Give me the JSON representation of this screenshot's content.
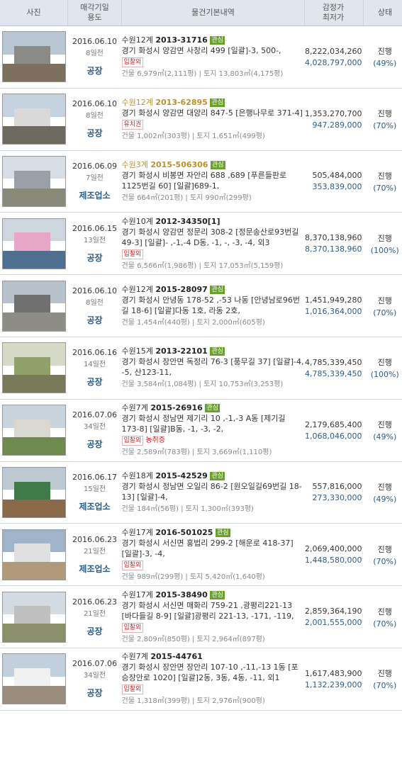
{
  "header": {
    "photo": "사진",
    "date_line1": "매각기일",
    "date_line2": "용도",
    "info": "물건기본내역",
    "price_line1": "감정가",
    "price_line2": "최저가",
    "status": "상태"
  },
  "rows": [
    {
      "date": "2016.06.10",
      "ago": "8일전",
      "usage": "공장",
      "court": "수원12계",
      "case": "2013-31716",
      "returned": false,
      "badge": "관심",
      "addr": "경기 화성시 양감면 사창리 499 [일괄]-3, 500-,",
      "tag": "입찰외",
      "tag2": "",
      "area": "건물 6,979㎡(2,111평) | 토지 13,803㎡(4,175평)",
      "appraisal": "8,222,034,260",
      "minimum": "4,028,797,000",
      "status": "진행",
      "pct": "(49%)"
    },
    {
      "date": "2016.06.10",
      "ago": "8일전",
      "usage": "공장",
      "court": "수원12계",
      "case": "2013-62895",
      "returned": true,
      "badge": "관심",
      "addr": "경기 화성시 양감면 대양리 847-5 [은행나무로 371-4]",
      "tag": "유치권",
      "tag2": "",
      "area": "건물 1,002㎡(303평) | 토지 1,651㎡(499평)",
      "appraisal": "1,353,270,700",
      "minimum": "947,289,000",
      "status": "진행",
      "pct": "(70%)"
    },
    {
      "date": "2016.06.09",
      "ago": "7일전",
      "usage": "제조업소",
      "court": "수원3계",
      "case": "2015-506306",
      "returned": true,
      "badge": "관심",
      "addr": "경기 화성시 비봉면 자안리 688 ,689 [푸른들판로1125번길 60] [일괄]689-1,",
      "tag": "",
      "tag2": "",
      "area": "건물 664㎡(201평) | 토지 990㎡(299평)",
      "appraisal": "505,484,000",
      "minimum": "353,839,000",
      "status": "진행",
      "pct": "(70%)"
    },
    {
      "date": "2016.06.15",
      "ago": "13일전",
      "usage": "공장",
      "court": "수원10계",
      "case": "2012-34350[1]",
      "returned": false,
      "badge": "",
      "addr": "경기 화성시 양감면 정문리 308-2 [정문송산로93번길 49-3] [일괄]- ,-1,-4 D동, -1, -, -3, -4, 외3",
      "tag": "입찰외",
      "tag2": "",
      "area": "건물 6,566㎡(1,986평) | 토지 17,053㎡(5,159평)",
      "appraisal": "8,370,138,960",
      "minimum": "8,370,138,960",
      "status": "진행",
      "pct": "(100%)"
    },
    {
      "date": "2016.06.10",
      "ago": "8일전",
      "usage": "공장",
      "court": "수원12계",
      "case": "2015-28097",
      "returned": false,
      "badge": "관심",
      "addr": "경기 화성시 안녕동 178-52 ,-53 나동 [안녕남로96번길 18-6] [일괄]다동 1호, 라동 2호,",
      "tag": "",
      "tag2": "",
      "area": "건물 1,454㎡(440평) | 토지 2,000㎡(605평)",
      "appraisal": "1,451,949,280",
      "minimum": "1,016,364,000",
      "status": "진행",
      "pct": "(70%)"
    },
    {
      "date": "2016.06.16",
      "ago": "14일전",
      "usage": "공장",
      "court": "수원15계",
      "case": "2013-22101",
      "returned": false,
      "badge": "관심",
      "addr": "경기 화성시 장안면 독정리 76-3 [풍무길 37] [일괄]-4, -5, 산123-11,",
      "tag": "",
      "tag2": "",
      "area": "건물 3,584㎡(1,084평) | 토지 10,753㎡(3,253평)",
      "appraisal": "4,785,339,450",
      "minimum": "4,785,339,450",
      "status": "진행",
      "pct": "(100%)"
    },
    {
      "date": "2016.07.06",
      "ago": "34일전",
      "usage": "공장",
      "court": "수원7계",
      "case": "2015-26916",
      "returned": false,
      "badge": "관심",
      "addr": "경기 화성시 정남면 제기리 10 ,-1,-3 A동 [제기길 173-8] [일괄]B동, -1, -3, -2,",
      "tag": "입찰외",
      "tag2": "농취증",
      "area": "건물 2,589㎡(783평) | 토지 3,669㎡(1,110평)",
      "appraisal": "2,179,685,400",
      "minimum": "1,068,046,000",
      "status": "진행",
      "pct": "(49%)"
    },
    {
      "date": "2016.06.17",
      "ago": "15일전",
      "usage": "제조업소",
      "court": "수원18계",
      "case": "2015-42529",
      "returned": false,
      "badge": "관심",
      "addr": "경기 화성시 정남면 오일리 86-2 [원오일길69번길 18-13] [일괄]-4,",
      "tag": "",
      "tag2": "",
      "area": "건물 184㎡(56평) | 토지 1,300㎡(393평)",
      "appraisal": "557,816,000",
      "minimum": "273,330,000",
      "status": "진행",
      "pct": "(49%)"
    },
    {
      "date": "2016.06.23",
      "ago": "21일전",
      "usage": "제조업소",
      "court": "수원17계",
      "case": "2016-501025",
      "returned": false,
      "badge": "관심",
      "addr": "경기 화성시 서신면 홍법리 299-2 [해운로 418-37] [일괄]-3, -4,",
      "tag": "입찰외",
      "tag2": "",
      "area": "건물 989㎡(299평) | 토지 5,420㎡(1,640평)",
      "appraisal": "2,069,400,000",
      "minimum": "1,448,580,000",
      "status": "진행",
      "pct": "(70%)"
    },
    {
      "date": "2016.06.23",
      "ago": "21일전",
      "usage": "공장",
      "court": "수원17계",
      "case": "2015-38490",
      "returned": false,
      "badge": "관심",
      "addr": "경기 화성시 서신면 매화리 759-21 ,광평리221-13 [바다들길 8-9] [일괄]광평리 221-13, -171, -119,",
      "tag": "입찰외",
      "tag2": "",
      "area": "건물 2,809㎡(850평) | 토지 2,964㎡(897평)",
      "appraisal": "2,859,364,190",
      "minimum": "2,001,555,000",
      "status": "진행",
      "pct": "(70%)"
    },
    {
      "date": "2016.07.06",
      "ago": "34일전",
      "usage": "공장",
      "court": "수원7계",
      "case": "2015-44761",
      "returned": false,
      "badge": "",
      "addr": "경기 화성시 장안면 장안리 107-10 ,-11,-13 1동 [포승장안로 1020] [일괄]2동, 3동, 4동, -11, 외1",
      "tag": "입찰외",
      "tag2": "",
      "area": "건물 1,318㎡(399평) | 토지 2,976㎡(900평)",
      "appraisal": "1,617,483,900",
      "minimum": "1,132,239,000",
      "status": "진행",
      "pct": "(70%)"
    }
  ]
}
